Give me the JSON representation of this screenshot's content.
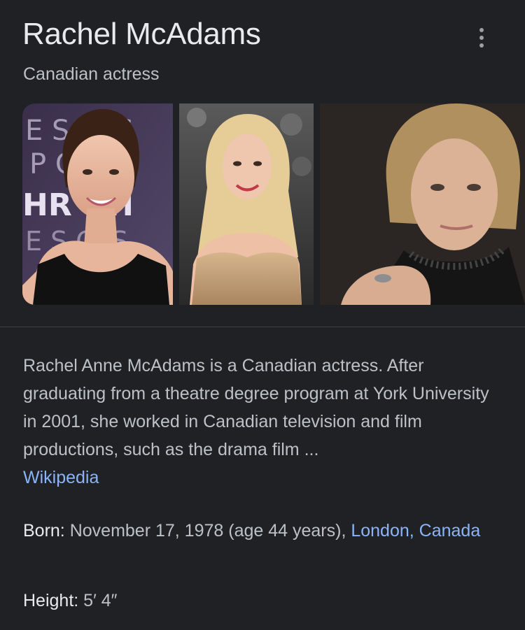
{
  "header": {
    "title": "Rachel McAdams",
    "subtitle": "Canadian actress",
    "more_icon": "more-vert-icon"
  },
  "images": [
    {
      "name": "portrait-event-backdrop"
    },
    {
      "name": "portrait-red-carpet"
    },
    {
      "name": "portrait-studio"
    }
  ],
  "image_backdrop_text": {
    "row1": "E S    CES",
    "row2": "P    CS",
    "row3": "HR   GH",
    "row4": "E S    CES"
  },
  "description": {
    "text": "Rachel Anne McAdams is a Canadian actress. After graduating from a theatre degree program at York University in 2001, she worked in Canadian television and film productions, such as the drama film ...",
    "source_link": "Wikipedia"
  },
  "facts": {
    "born": {
      "label": "Born:",
      "value": "November 17, 1978 (age 44 years),",
      "link": "London, Canada"
    },
    "height": {
      "label": "Height:",
      "value": "5′ 4″"
    }
  },
  "colors": {
    "background": "#202124",
    "title": "#e8eaed",
    "text": "#bdc1c6",
    "link": "#8ab4f8",
    "divider": "#3c4043"
  }
}
